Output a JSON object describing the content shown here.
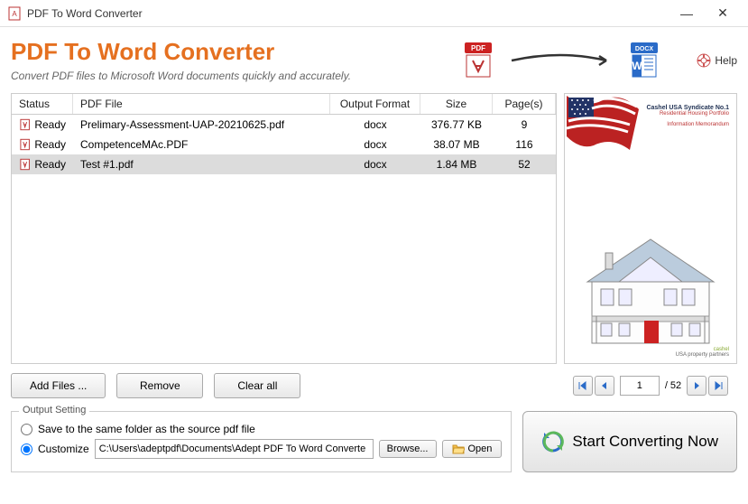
{
  "window": {
    "title": "PDF To Word Converter"
  },
  "header": {
    "title": "PDF To Word Converter",
    "subtitle": "Convert PDF files to Microsoft Word documents quickly and accurately.",
    "pdf_badge": "PDF",
    "docx_badge": "DOCX",
    "help": "Help"
  },
  "table": {
    "headers": {
      "status": "Status",
      "file": "PDF File",
      "format": "Output Format",
      "size": "Size",
      "pages": "Page(s)"
    },
    "rows": [
      {
        "status": "Ready",
        "file": "Prelimary-Assessment-UAP-20210625.pdf",
        "format": "docx",
        "size": "376.77 KB",
        "pages": "9",
        "selected": false
      },
      {
        "status": "Ready",
        "file": "CompetenceMAc.PDF",
        "format": "docx",
        "size": "38.07 MB",
        "pages": "116",
        "selected": false
      },
      {
        "status": "Ready",
        "file": "Test #1.pdf",
        "format": "docx",
        "size": "1.84 MB",
        "pages": "52",
        "selected": true
      }
    ]
  },
  "preview": {
    "title1": "Cashel USA Syndicate No.1",
    "title2": "Residential Housing Portfolio",
    "title3": "Information Memorandum",
    "footer1": "cashel",
    "footer2": "USA property partners"
  },
  "buttons": {
    "add": "Add Files ...",
    "remove": "Remove",
    "clear": "Clear all"
  },
  "pager": {
    "current": "1",
    "total": "/ 52"
  },
  "output": {
    "legend": "Output Setting",
    "same_folder": "Save to the same folder as the source pdf file",
    "customize": "Customize",
    "path": "C:\\Users\\adeptpdf\\Documents\\Adept PDF To Word Converte",
    "browse": "Browse...",
    "open": "Open"
  },
  "convert": {
    "label": "Start Converting Now"
  }
}
